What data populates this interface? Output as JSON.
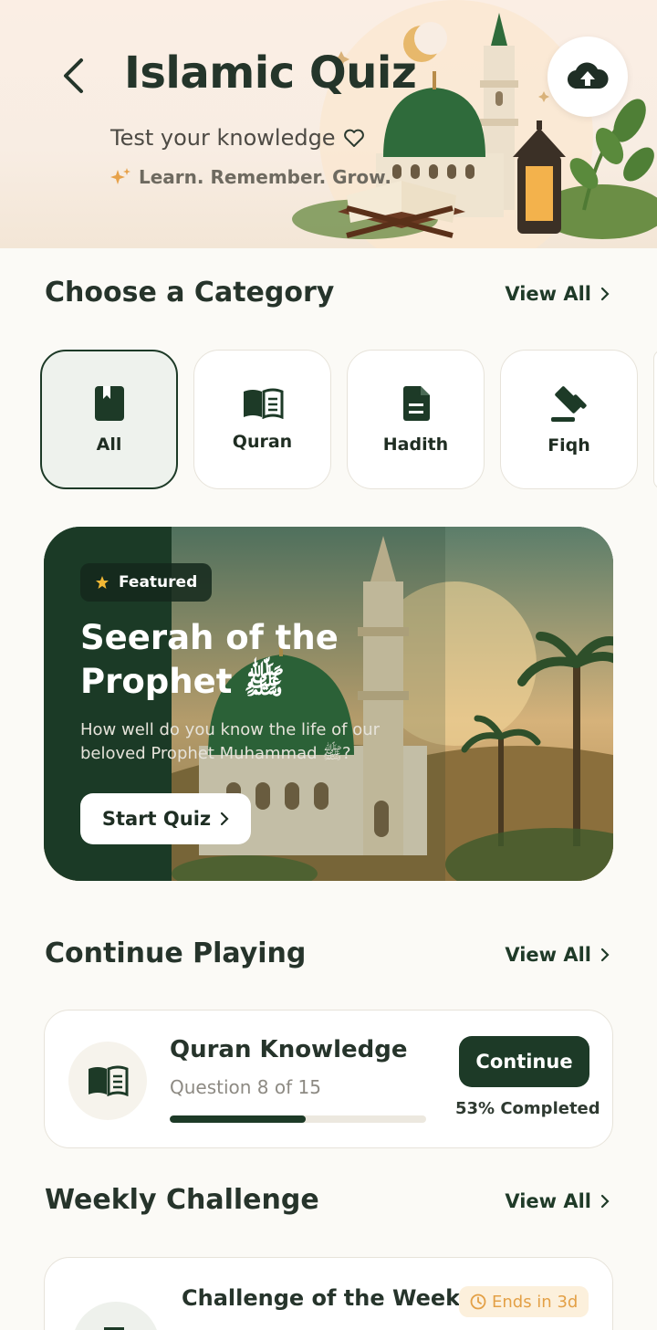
{
  "header": {
    "title": "Islamic Quiz",
    "subtitle": "Test your knowledge",
    "tagline": "Learn. Remember. Grow."
  },
  "categories": {
    "title": "Choose a Category",
    "view_all": "View All",
    "items": [
      {
        "label": "All",
        "icon": "bookmark-book-icon",
        "active": true
      },
      {
        "label": "Quran",
        "icon": "open-book-icon",
        "active": false
      },
      {
        "label": "Hadith",
        "icon": "document-icon",
        "active": false
      },
      {
        "label": "Fiqh",
        "icon": "gavel-icon",
        "active": false
      }
    ]
  },
  "featured": {
    "badge": "Featured",
    "title": "Seerah of the Prophet ﷺ",
    "description": "How well do you know the life of our beloved Prophet Muhammad ﷺ?",
    "button": "Start Quiz"
  },
  "continue": {
    "title": "Continue Playing",
    "view_all": "View All",
    "quiz_title": "Quran Knowledge",
    "question_text": "Question 8 of 15",
    "button": "Continue",
    "completed_text": "53% Completed",
    "progress": 0.53
  },
  "weekly": {
    "title": "Weekly Challenge",
    "view_all": "View All",
    "card_title": "Challenge of the Week",
    "badge": "Ends in 3d"
  },
  "colors": {
    "primary": "#1d3a27",
    "background": "#fbfaf6",
    "accent_gold": "#e3a046",
    "header_bg": "#f8ede3"
  }
}
